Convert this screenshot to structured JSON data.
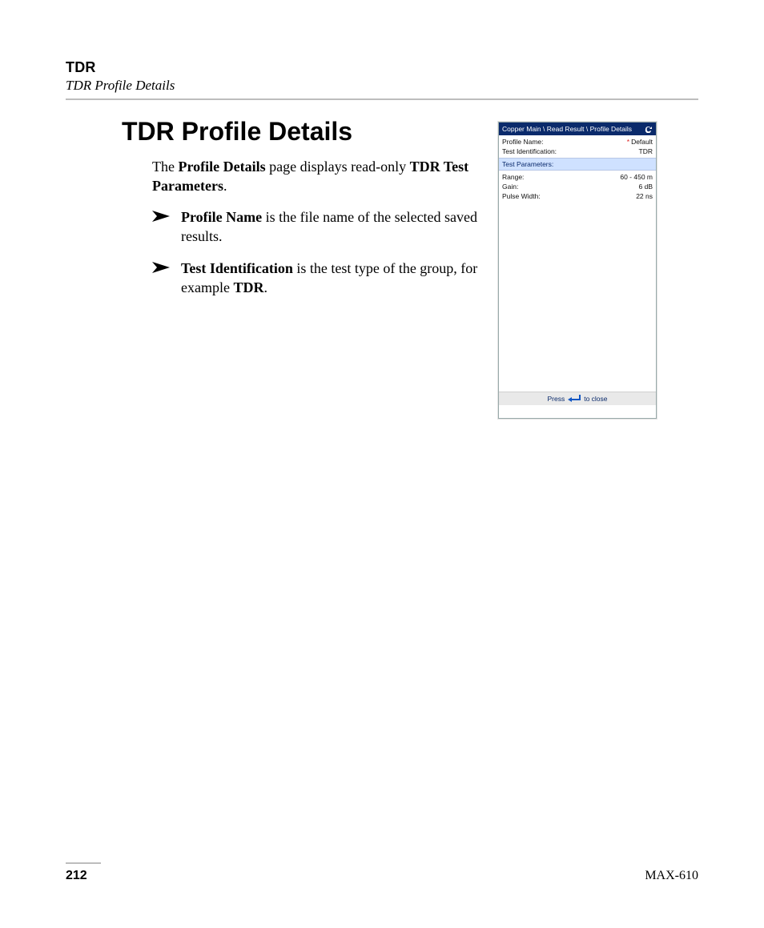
{
  "header": {
    "title": "TDR",
    "subtitle": "TDR Profile Details"
  },
  "main": {
    "heading": "TDR Profile Details",
    "intro_prefix": "The ",
    "intro_b1": "Profile Details",
    "intro_mid": " page displays read-only ",
    "intro_b2": "TDR Test Parameters",
    "intro_suffix": ".",
    "bullets": [
      {
        "term": "Profile Name",
        "rest": " is the file name of the selected saved results."
      },
      {
        "term": "Test Identification",
        "rest": " is the test type of the group, for example ",
        "tail_b": "TDR",
        "tail_suffix": "."
      }
    ]
  },
  "device": {
    "breadcrumb": "Copper Main \\ Read Result \\ Profile Details",
    "rows_top": [
      {
        "label": "Profile Name:",
        "value": "Default",
        "starred": true
      },
      {
        "label": "Test Identification:",
        "value": "TDR",
        "starred": false
      }
    ],
    "section": "Test Parameters:",
    "rows_params": [
      {
        "label": "Range:",
        "value": "60 - 450 m"
      },
      {
        "label": "Gain:",
        "value": "6 dB"
      },
      {
        "label": "Pulse Width:",
        "value": "22 ns"
      }
    ],
    "footer_prefix": "Press",
    "footer_suffix": "to close"
  },
  "footer": {
    "page": "212",
    "model": "MAX-610"
  }
}
